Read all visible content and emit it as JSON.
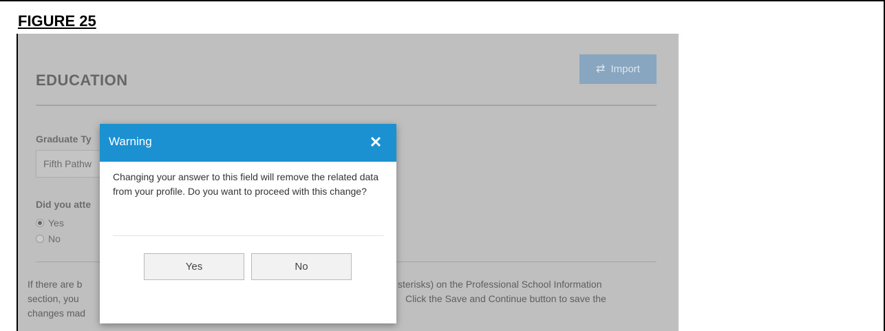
{
  "figure_label": "FIGURE 25",
  "page": {
    "title": "EDUCATION",
    "import_button": {
      "icon": "swap-arrows-icon",
      "label": "Import"
    },
    "graduate_type": {
      "label": "Graduate Ty",
      "value": "Fifth Pathw"
    },
    "attend_question": {
      "label": "Did you atte",
      "options": [
        {
          "label": "Yes",
          "selected": true
        },
        {
          "label": "No",
          "selected": false
        }
      ]
    },
    "info_text": {
      "line1_left": "If there are b",
      "line1_right": "sterisks) on the Professional School Information",
      "line2_left": "section, you",
      "line2_right": "Click the Save and Continue button to save the",
      "line3_left": "changes mad"
    }
  },
  "dialog": {
    "title": "Warning",
    "close_icon": "close-icon",
    "message": "Changing your answer to this field will remove the related data from your profile. Do you want to proceed with this change?",
    "yes_label": "Yes",
    "no_label": "No"
  },
  "colors": {
    "header": "#1b91d2",
    "overlay_background": "#bfbfbf",
    "import_button": "#88a6bf"
  }
}
